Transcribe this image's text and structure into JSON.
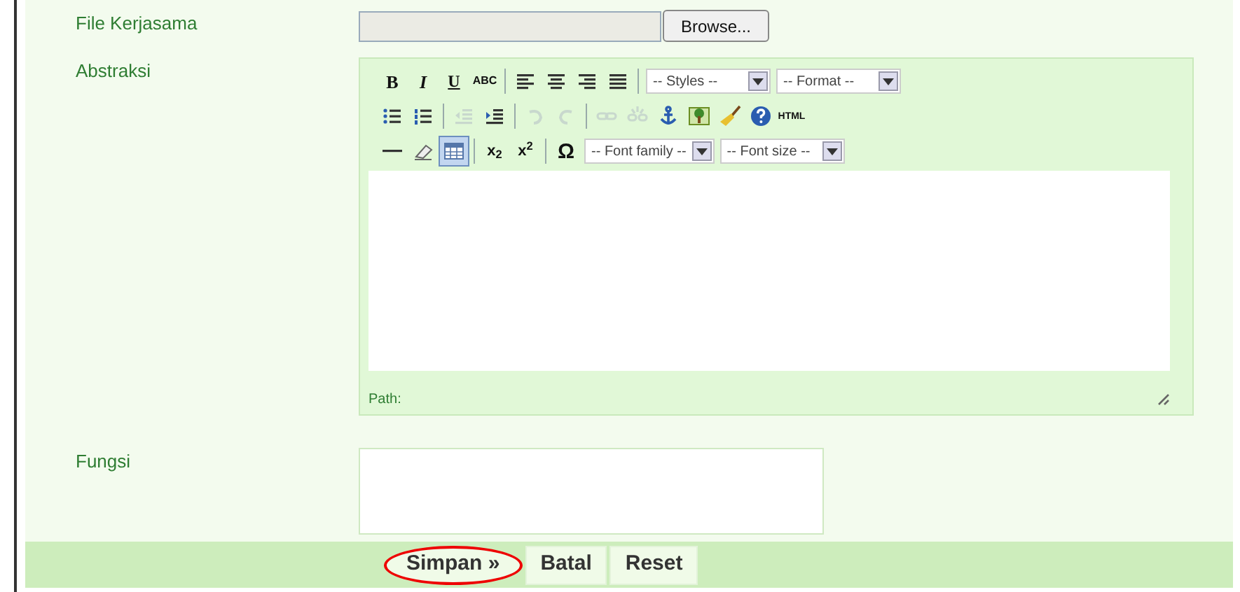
{
  "fields": [
    {
      "label": "File Kerjasama",
      "kind": "file",
      "button": "Browse..."
    },
    {
      "label": "Abstraksi",
      "kind": "editor"
    },
    {
      "label": "Fungsi",
      "kind": "textarea"
    }
  ],
  "toolbar": [
    [
      {
        "kind": "bold",
        "label": "B",
        "disabled": false,
        "selected": false
      },
      {
        "kind": "italic",
        "label": "I",
        "disabled": false,
        "selected": false
      },
      {
        "kind": "underline",
        "label": "U",
        "disabled": false,
        "selected": false
      },
      {
        "kind": "strike",
        "label": "ABC",
        "disabled": false,
        "selected": false
      },
      {
        "kind": "separator"
      },
      {
        "kind": "align-left",
        "disabled": false,
        "selected": false
      },
      {
        "kind": "align-center",
        "disabled": false,
        "selected": false
      },
      {
        "kind": "align-right",
        "disabled": false,
        "selected": false
      },
      {
        "kind": "align-justify",
        "disabled": false,
        "selected": false
      },
      {
        "kind": "separator"
      },
      {
        "kind": "select",
        "label": "-- Styles --"
      },
      {
        "kind": "select",
        "label": "-- Format --"
      }
    ],
    [
      {
        "kind": "bullets",
        "disabled": false,
        "selected": false
      },
      {
        "kind": "numbers",
        "disabled": false,
        "selected": false
      },
      {
        "kind": "separator"
      },
      {
        "kind": "outdent",
        "disabled": true,
        "selected": false
      },
      {
        "kind": "indent",
        "disabled": false,
        "selected": false
      },
      {
        "kind": "separator"
      },
      {
        "kind": "undo",
        "disabled": true,
        "selected": false
      },
      {
        "kind": "redo",
        "disabled": true,
        "selected": false
      },
      {
        "kind": "separator"
      },
      {
        "kind": "link",
        "disabled": true,
        "selected": false
      },
      {
        "kind": "unlink",
        "disabled": true,
        "selected": false
      },
      {
        "kind": "anchor",
        "disabled": false,
        "selected": false
      },
      {
        "kind": "image",
        "disabled": false,
        "selected": false
      },
      {
        "kind": "cleanup",
        "disabled": false,
        "selected": false
      },
      {
        "kind": "help",
        "disabled": false,
        "selected": false
      },
      {
        "kind": "html",
        "label": "HTML",
        "disabled": false,
        "selected": false
      }
    ],
    [
      {
        "kind": "rule",
        "disabled": false,
        "selected": false
      },
      {
        "kind": "eraser",
        "disabled": false,
        "selected": false
      },
      {
        "kind": "table",
        "disabled": false,
        "selected": true
      },
      {
        "kind": "separator"
      },
      {
        "kind": "script",
        "label": "x$_{2}$",
        "disabled": false,
        "selected": false
      },
      {
        "kind": "script",
        "label": "x$^{2}$",
        "disabled": false,
        "selected": false
      },
      {
        "kind": "separator"
      },
      {
        "kind": "omega",
        "label": "Ω",
        "disabled": false,
        "selected": false
      },
      {
        "kind": "select",
        "label": "-- Font family --"
      },
      {
        "kind": "select",
        "label": "-- Font size --"
      }
    ]
  ],
  "path_label": "Path:",
  "actions": [
    {
      "label": "Simpan »",
      "highlighted": true
    },
    {
      "label": "Batal",
      "highlighted": false
    },
    {
      "label": "Reset",
      "highlighted": false
    }
  ]
}
